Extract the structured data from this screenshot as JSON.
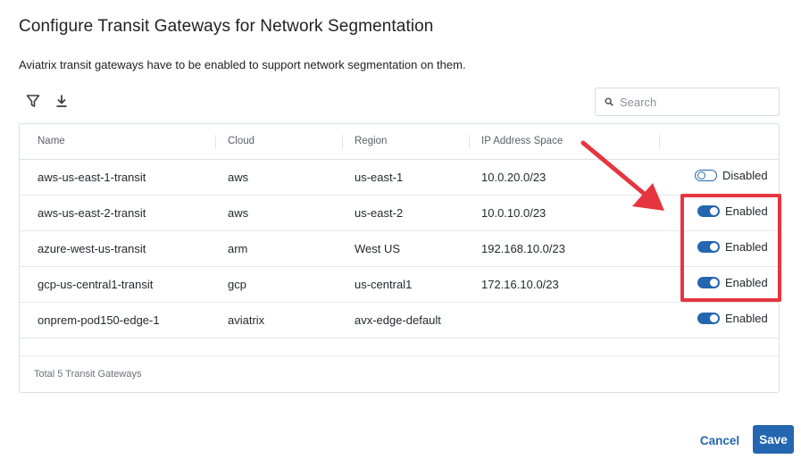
{
  "dialog": {
    "title": "Configure Transit Gateways for Network Segmentation",
    "subtitle": "Aviatrix transit gateways have to be enabled to support network segmentation on them."
  },
  "toolbar": {
    "filter_icon": "filter-icon",
    "download_icon": "download-icon",
    "search_placeholder": "Search",
    "search_value": ""
  },
  "table": {
    "columns": [
      "Name",
      "Cloud",
      "Region",
      "IP Address Space",
      ""
    ],
    "rows": [
      {
        "name": "aws-us-east-1-transit",
        "cloud": "aws",
        "region": "us-east-1",
        "ip": "10.0.20.0/23",
        "enabled": false,
        "status": "Disabled"
      },
      {
        "name": "aws-us-east-2-transit",
        "cloud": "aws",
        "region": "us-east-2",
        "ip": "10.0.10.0/23",
        "enabled": true,
        "status": "Enabled"
      },
      {
        "name": "azure-west-us-transit",
        "cloud": "arm",
        "region": "West US",
        "ip": "192.168.10.0/23",
        "enabled": true,
        "status": "Enabled"
      },
      {
        "name": "gcp-us-central1-transit",
        "cloud": "gcp",
        "region": "us-central1",
        "ip": "172.16.10.0/23",
        "enabled": true,
        "status": "Enabled"
      },
      {
        "name": "onprem-pod150-edge-1",
        "cloud": "aviatrix",
        "region": "avx-edge-default",
        "ip": "",
        "enabled": true,
        "status": "Enabled"
      }
    ],
    "footer": "Total 5 Transit Gateways"
  },
  "actions": {
    "cancel_label": "Cancel",
    "save_label": "Save"
  },
  "colors": {
    "accent": "#2566b0",
    "annotation": "#e53640"
  }
}
